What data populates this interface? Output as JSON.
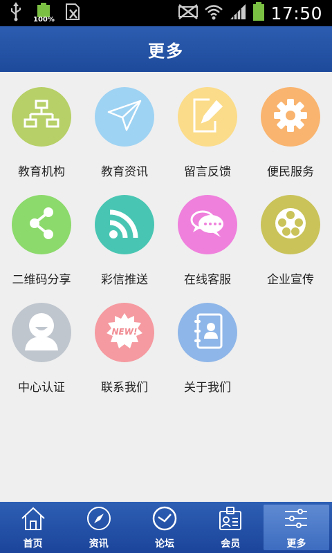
{
  "status_bar": {
    "battery_percent": "100%",
    "time": "17:50",
    "icons": [
      "usb-icon",
      "battery-icon",
      "sim-icon",
      "mute-icon",
      "wifi-icon",
      "signal-icon",
      "battery-icon"
    ]
  },
  "header": {
    "title": "更多"
  },
  "grid": {
    "items": [
      {
        "label": "教育机构",
        "icon": "org-chart-icon",
        "color": "#b7d067"
      },
      {
        "label": "教育资讯",
        "icon": "paper-plane-icon",
        "color": "#9fd3f3"
      },
      {
        "label": "留言反馈",
        "icon": "edit-icon",
        "color": "#fbdc8a"
      },
      {
        "label": "便民服务",
        "icon": "gear-icon",
        "color": "#f9b46f"
      },
      {
        "label": "二维码分享",
        "icon": "share-icon",
        "color": "#8cda6b"
      },
      {
        "label": "彩信推送",
        "icon": "rss-icon",
        "color": "#49c6b3"
      },
      {
        "label": "在线客服",
        "icon": "chat-icon",
        "color": "#ef80dc"
      },
      {
        "label": "企业宣传",
        "icon": "film-reel-icon",
        "color": "#c9c35a"
      },
      {
        "label": "中心认证",
        "icon": "user-icon",
        "color": "#c0c6ce"
      },
      {
        "label": "联系我们",
        "icon": "new-badge-icon",
        "color": "#f59aa0"
      },
      {
        "label": "关于我们",
        "icon": "contacts-book-icon",
        "color": "#8fb6e8"
      }
    ]
  },
  "bottom_nav": {
    "active": 4,
    "items": [
      {
        "label": "首页",
        "icon": "home-icon"
      },
      {
        "label": "资讯",
        "icon": "compass-icon"
      },
      {
        "label": "论坛",
        "icon": "clock-icon"
      },
      {
        "label": "会员",
        "icon": "member-card-icon"
      },
      {
        "label": "更多",
        "icon": "sliders-icon"
      }
    ]
  }
}
